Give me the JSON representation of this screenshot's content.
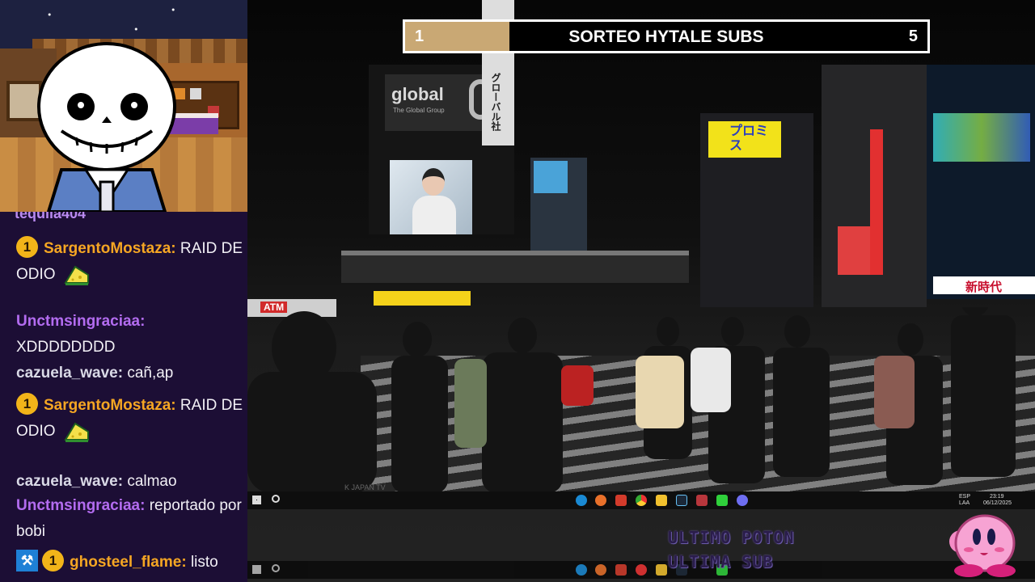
{
  "goal": {
    "current": "1",
    "title": "SORTEO HYTALE SUBS",
    "target": "5",
    "progress": 0.2
  },
  "chat": {
    "partial_top": "tequila404",
    "messages": [
      {
        "badge": "1",
        "user": "SargentoMostaza:",
        "user_color": "#f5a623",
        "text": "RAID DE ODIO",
        "emote": "cheese-emote"
      },
      {
        "user": "Unctmsingraciaa:",
        "user_color": "#b36cf0",
        "text": "XDDDDDDDD"
      },
      {
        "user": "cazuela_wave:",
        "user_color": "#d9d9e6",
        "text": "cañ,ap"
      },
      {
        "badge": "1",
        "user": "SargentoMostaza:",
        "user_color": "#f5a623",
        "text": "RAID DE ODIO",
        "emote": "cheese-emote"
      },
      {
        "user": "cazuela_wave:",
        "user_color": "#d9d9e6",
        "text": "calmao"
      },
      {
        "user": "Unctmsingraciaa:",
        "user_color": "#b36cf0",
        "text": "reportado por bobi"
      },
      {
        "mod": true,
        "badge": "1",
        "user": "ghosteel_flame:",
        "user_color": "#f5a623",
        "text": "listo"
      }
    ]
  },
  "stream": {
    "signs": {
      "global": "global",
      "global_sub": "The Global Group",
      "puromisu": "プロミス",
      "kanji_side": "グローバル社",
      "shinjidai": "新時代",
      "atm": "ATM",
      "watermark": "K JAPAN TV"
    },
    "overlay": {
      "line1": "ULTIMO POTON",
      "line2": "ULTIMA SUB"
    },
    "taskbar": {
      "lang1": "ESP",
      "lang2": "LAA",
      "time": "23:19",
      "date": "06/12/2025"
    }
  }
}
